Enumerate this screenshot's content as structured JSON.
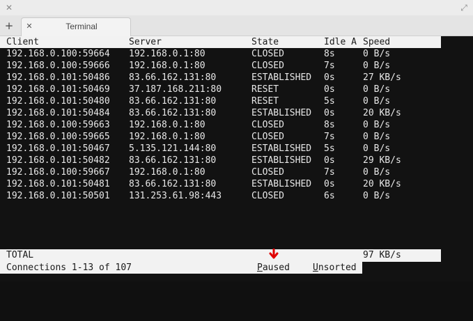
{
  "window": {
    "close_glyph": "✕",
    "maximize_glyph": "⤢"
  },
  "tabs": {
    "new_tab_glyph": "+",
    "close_glyph": "✕",
    "items": [
      {
        "label": "Terminal"
      }
    ]
  },
  "table": {
    "headers": {
      "client": "Client",
      "server": "Server",
      "state": "State",
      "idle": "Idle A",
      "speed": "Speed"
    },
    "rows": [
      {
        "client": "192.168.0.100:59664",
        "server": "192.168.0.1:80",
        "state": "CLOSED",
        "idle": "8s",
        "speed": "0 B/s"
      },
      {
        "client": "192.168.0.100:59666",
        "server": "192.168.0.1:80",
        "state": "CLOSED",
        "idle": "7s",
        "speed": "0 B/s"
      },
      {
        "client": "192.168.0.101:50486",
        "server": "83.66.162.131:80",
        "state": "ESTABLISHED",
        "idle": "0s",
        "speed": "27 KB/s"
      },
      {
        "client": "192.168.0.101:50469",
        "server": "37.187.168.211:80",
        "state": "RESET",
        "idle": "0s",
        "speed": "0 B/s"
      },
      {
        "client": "192.168.0.101:50480",
        "server": "83.66.162.131:80",
        "state": "RESET",
        "idle": "5s",
        "speed": "0 B/s"
      },
      {
        "client": "192.168.0.101:50484",
        "server": "83.66.162.131:80",
        "state": "ESTABLISHED",
        "idle": "0s",
        "speed": "20 KB/s"
      },
      {
        "client": "192.168.0.100:59663",
        "server": "192.168.0.1:80",
        "state": "CLOSED",
        "idle": "8s",
        "speed": "0 B/s"
      },
      {
        "client": "192.168.0.100:59665",
        "server": "192.168.0.1:80",
        "state": "CLOSED",
        "idle": "7s",
        "speed": "0 B/s"
      },
      {
        "client": "192.168.0.101:50467",
        "server": "5.135.121.144:80",
        "state": "ESTABLISHED",
        "idle": "5s",
        "speed": "0 B/s"
      },
      {
        "client": "192.168.0.101:50482",
        "server": "83.66.162.131:80",
        "state": "ESTABLISHED",
        "idle": "0s",
        "speed": "29 KB/s"
      },
      {
        "client": "192.168.0.100:59667",
        "server": "192.168.0.1:80",
        "state": "CLOSED",
        "idle": "7s",
        "speed": "0 B/s"
      },
      {
        "client": "192.168.0.101:50481",
        "server": "83.66.162.131:80",
        "state": "ESTABLISHED",
        "idle": "0s",
        "speed": "20 KB/s"
      },
      {
        "client": "192.168.0.101:50501",
        "server": "131.253.61.98:443",
        "state": "CLOSED",
        "idle": "6s",
        "speed": "0 B/s"
      }
    ]
  },
  "footer": {
    "total_label": "TOTAL",
    "total_speed": "97 KB/s",
    "connections": "Connections 1-13 of 107",
    "paused": "Paused",
    "unsorted": "Unsorted"
  },
  "colors": {
    "terminal_bg": "#121212",
    "terminal_fg": "#e8e8e8",
    "bar_bg": "#f2f2f2",
    "bar_fg": "#1a1a1a",
    "annotation_mark": "#e00000"
  }
}
